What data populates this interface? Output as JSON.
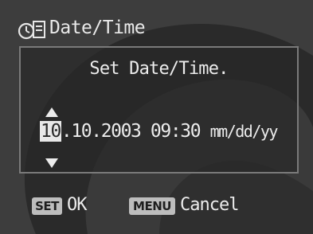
{
  "screen": {
    "title": "Date/Time",
    "title_icon": "clock-settings-icon"
  },
  "panel": {
    "prompt": "Set Date/Time.",
    "datetime": {
      "month": "10",
      "rest": ".10.2003 09:30",
      "format": "mm/dd/yy"
    },
    "up_icon": "triangle-up-icon",
    "down_icon": "triangle-down-icon"
  },
  "footer": {
    "set_key": "SET",
    "ok_label": "OK",
    "menu_key": "MENU",
    "cancel_label": "Cancel"
  },
  "colors": {
    "background": "#2b2b2b",
    "text": "#ececec",
    "highlight": "#e8e8e8",
    "key_badge": "#bdbdbd"
  }
}
